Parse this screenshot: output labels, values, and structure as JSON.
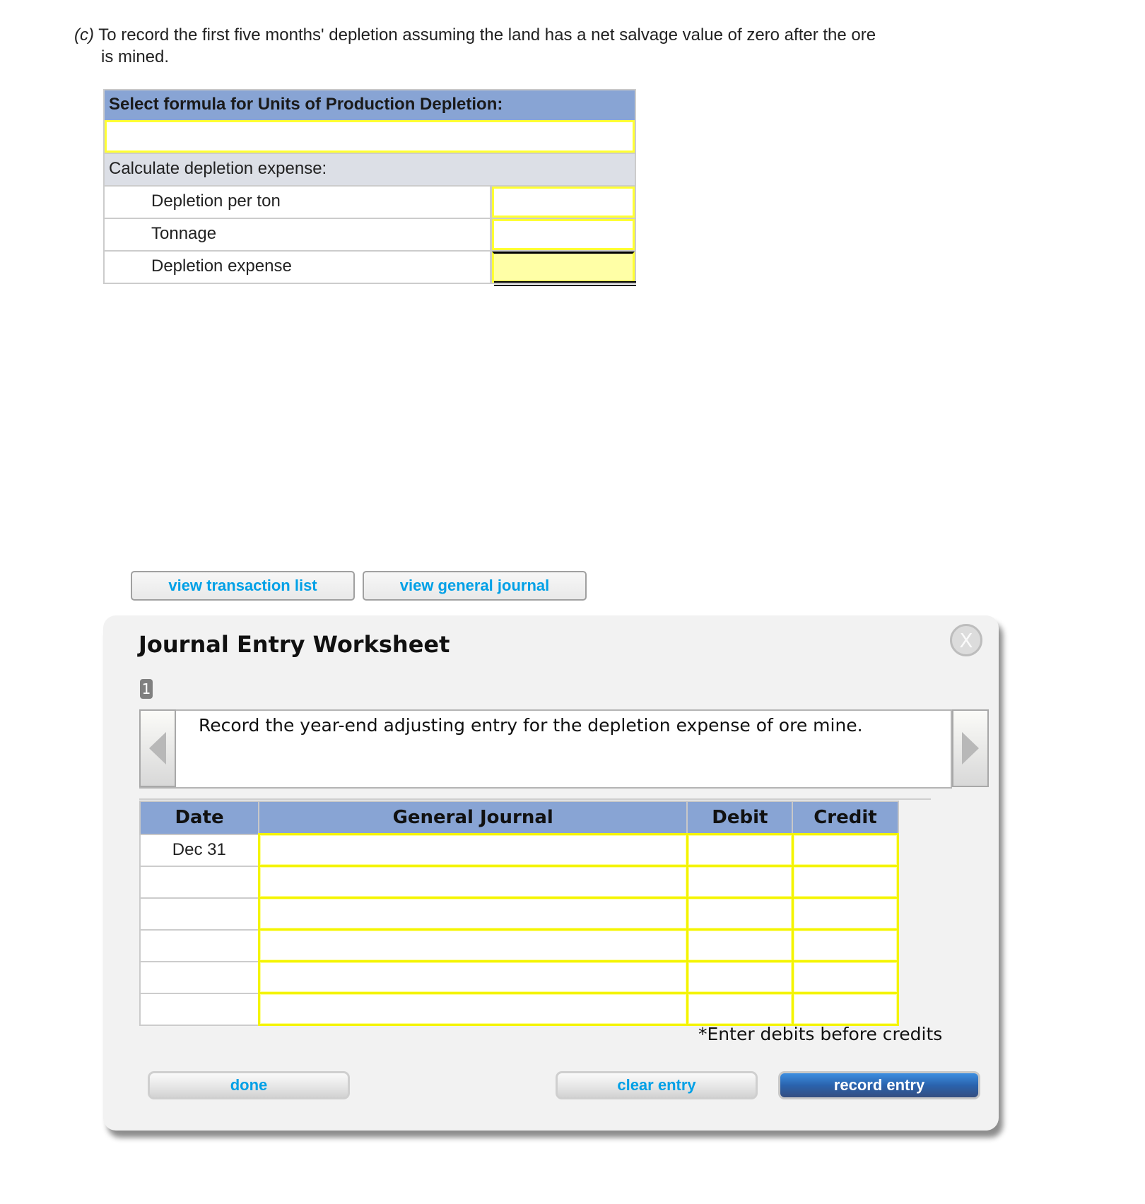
{
  "question": {
    "part": "(c)",
    "text_line1": "To record the first five months' depletion assuming the land has a net salvage value of zero after the ore",
    "text_line2": "is mined."
  },
  "formula_table": {
    "header": "Select formula for Units of Production Depletion:",
    "formula_value": "",
    "section_label": "Calculate depletion expense:",
    "rows": [
      {
        "label": "Depletion per ton",
        "value": ""
      },
      {
        "label": "Tonnage",
        "value": ""
      },
      {
        "label": "Depletion expense",
        "value": ""
      }
    ]
  },
  "toolbar": {
    "view_transaction_list": "view transaction list",
    "view_general_journal": "view general journal"
  },
  "worksheet": {
    "title": "Journal Entry Worksheet",
    "close_label": "X",
    "page_badge": "1",
    "description": "Record the year-end adjusting entry for the depletion expense of ore mine.",
    "columns": [
      "Date",
      "General Journal",
      "Debit",
      "Credit"
    ],
    "rows": [
      {
        "date": "Dec 31",
        "account": "",
        "debit": "",
        "credit": ""
      },
      {
        "date": "",
        "account": "",
        "debit": "",
        "credit": ""
      },
      {
        "date": "",
        "account": "",
        "debit": "",
        "credit": ""
      },
      {
        "date": "",
        "account": "",
        "debit": "",
        "credit": ""
      },
      {
        "date": "",
        "account": "",
        "debit": "",
        "credit": ""
      },
      {
        "date": "",
        "account": "",
        "debit": "",
        "credit": ""
      }
    ],
    "note": "*Enter debits before credits",
    "buttons": {
      "done": "done",
      "clear_entry": "clear entry",
      "record_entry": "record entry"
    }
  },
  "colors": {
    "header_blue": "#88a4d4",
    "input_border_yellow": "#ffff33",
    "total_fill_yellow": "#ffffa6",
    "link_blue": "#00a0e6",
    "primary_button_blue": "#2a63ad"
  }
}
